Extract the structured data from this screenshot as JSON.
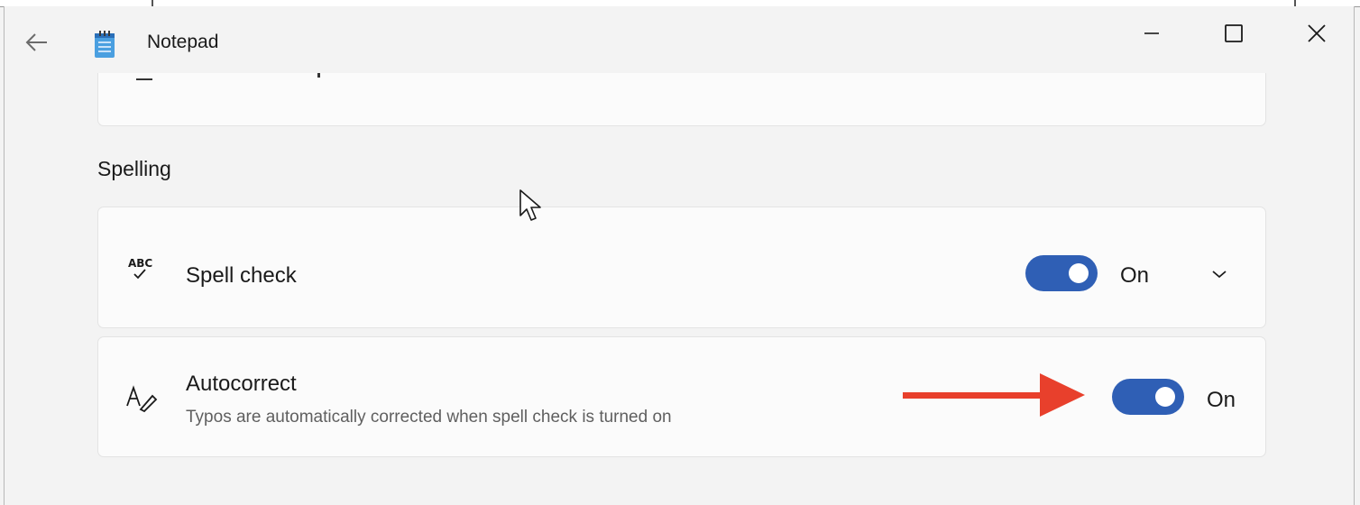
{
  "titlebar": {
    "app_title": "Notepad",
    "back_icon": "back-arrow-icon",
    "app_icon": "notepad-icon",
    "controls": [
      "minimize-icon",
      "maximize-icon",
      "close-icon"
    ]
  },
  "settings": {
    "section_title": "Spelling",
    "spell_check": {
      "label": "Spell check",
      "icon": "spell-check-icon",
      "toggle_state": "On",
      "toggle_on": true,
      "expander_icon": "chevron-down-icon"
    },
    "autocorrect": {
      "label": "Autocorrect",
      "description": "Typos are automatically corrected when spell check is turned on",
      "icon": "autocorrect-icon",
      "toggle_state": "On",
      "toggle_on": true
    }
  },
  "annotation": {
    "arrow_color": "#e8402c"
  },
  "colors": {
    "accent": "#2f5fb5",
    "background": "#f3f3f3",
    "card": "#fbfbfb"
  }
}
